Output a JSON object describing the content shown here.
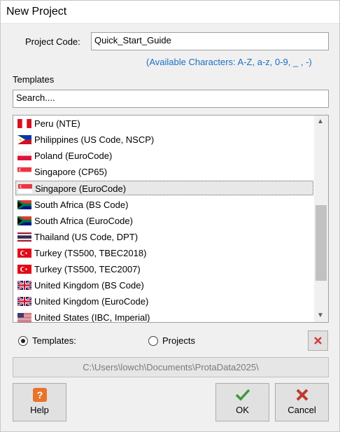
{
  "window": {
    "title": "New Project"
  },
  "project_code": {
    "label": "Project Code:",
    "value": "Quick_Start_Guide",
    "hint": "(Available Characters: A-Z, a-z, 0-9, _ , -)"
  },
  "templates": {
    "heading": "Templates",
    "search_value": "Search....",
    "items": [
      {
        "label": "Peru (NTE)",
        "flag": "flag-peru-icon"
      },
      {
        "label": "Philippines (US Code, NSCP)",
        "flag": "flag-philippines-icon"
      },
      {
        "label": "Poland (EuroCode)",
        "flag": "flag-poland-icon"
      },
      {
        "label": "Singapore (CP65)",
        "flag": "flag-singapore-icon"
      },
      {
        "label": "Singapore (EuroCode)",
        "flag": "flag-singapore-icon",
        "selected": true
      },
      {
        "label": "South Africa (BS Code)",
        "flag": "flag-south-africa-icon"
      },
      {
        "label": "South Africa (EuroCode)",
        "flag": "flag-south-africa-icon"
      },
      {
        "label": "Thailand (US Code, DPT)",
        "flag": "flag-thailand-icon"
      },
      {
        "label": "Turkey (TS500, TBEC2018)",
        "flag": "flag-turkey-icon"
      },
      {
        "label": "Turkey (TS500, TEC2007)",
        "flag": "flag-turkey-icon"
      },
      {
        "label": "United Kingdom (BS Code)",
        "flag": "flag-uk-icon"
      },
      {
        "label": "United Kingdom (EuroCode)",
        "flag": "flag-uk-icon"
      },
      {
        "label": "United States (IBC, Imperial)",
        "flag": "flag-usa-icon"
      }
    ]
  },
  "mode": {
    "templates_label": "Templates:",
    "projects_label": "Projects",
    "selected": "templates"
  },
  "path": "C:\\Users\\lowch\\Documents\\ProtaData2025\\",
  "buttons": {
    "help": "Help",
    "ok": "OK",
    "cancel": "Cancel"
  },
  "colors": {
    "hint": "#1a6fc4",
    "ok_check": "#3a9a3a",
    "cancel_x": "#c0392b",
    "help_icon": "#e8742c"
  }
}
